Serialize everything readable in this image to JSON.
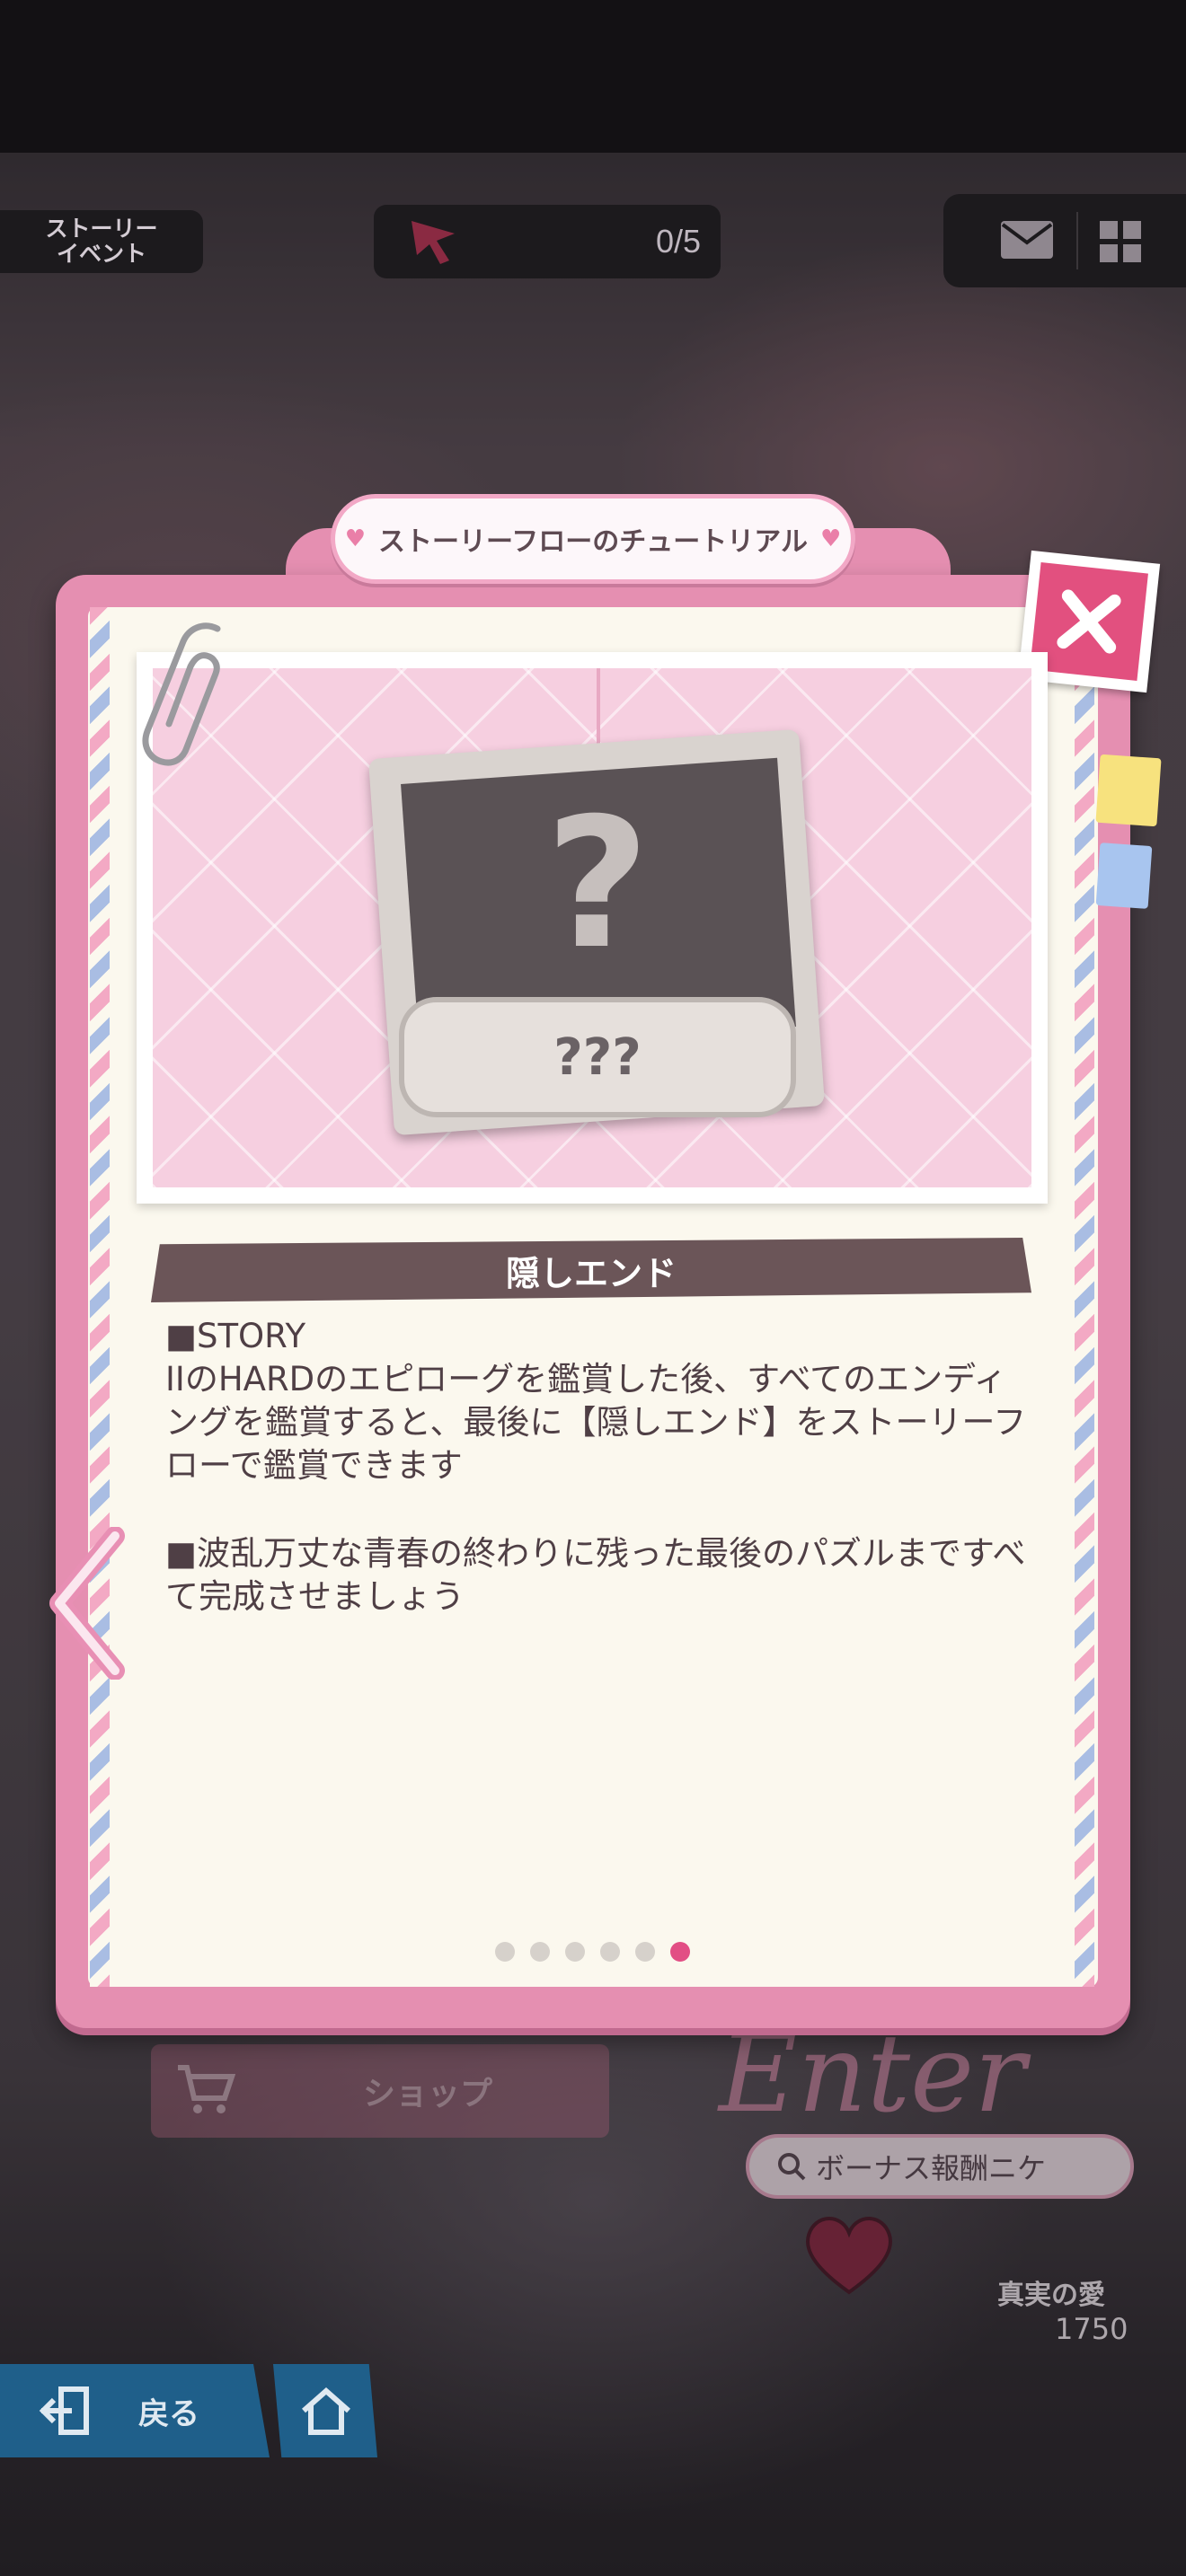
{
  "header": {
    "story_event_tag": "ストーリー\nイベント",
    "counter": "0/5"
  },
  "modal": {
    "title": "ストーリーフローのチュートリアル",
    "card_label": "???",
    "section_title": "隠しエンド",
    "paragraph_1": "■STORY\nIIのHARDのエピローグを鑑賞した後、すべてのエンディングを鑑賞すると、最後に【隠しエンド】をストーリーフローで鑑賞できます",
    "paragraph_2": "■波乱万丈な青春の終わりに残った最後のパズルまですべて完成させましょう",
    "page_count": 6,
    "active_page": 6
  },
  "background": {
    "shop_label": "ショップ",
    "bonus_label": "ボーナス報酬ニケ",
    "enter_text": "Enter",
    "love_label": "真実の愛",
    "love_value": "1750"
  },
  "footer": {
    "back_label": "戻る"
  },
  "colors": {
    "modal_pink": "#e58fb1",
    "accent": "#e24e84",
    "paper": "#fbf8ee",
    "banner": "#6b5558"
  }
}
